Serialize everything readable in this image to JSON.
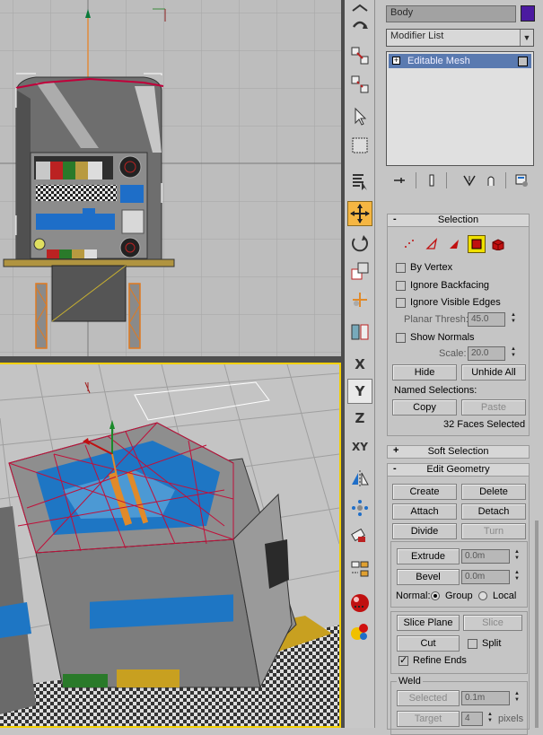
{
  "object": {
    "name": "Body",
    "color": "#4b1aa0"
  },
  "modifier_list": {
    "label": "Modifier List"
  },
  "stack": {
    "items": [
      {
        "label": "Editable Mesh"
      }
    ]
  },
  "toolbar": {
    "axis_x": "X",
    "axis_y": "Y",
    "axis_z": "Z",
    "axis_xy": "XY"
  },
  "selection": {
    "title": "Selection",
    "levels": [
      "vertex-icon",
      "edge-icon",
      "face-icon",
      "polygon-icon",
      "element-icon"
    ],
    "active_level": "polygon-icon",
    "by_vertex": "By Vertex",
    "ignore_backfacing": "Ignore Backfacing",
    "ignore_visible_edges": "Ignore Visible Edges",
    "planar_thresh_label": "Planar Thresh:",
    "planar_thresh_value": "45.0",
    "show_normals": "Show Normals",
    "scale_label": "Scale:",
    "scale_value": "20.0",
    "hide": "Hide",
    "unhide_all": "Unhide All",
    "named_selections": "Named Selections:",
    "copy": "Copy",
    "paste": "Paste",
    "status": "32 Faces Selected"
  },
  "soft_selection": {
    "title": "Soft Selection",
    "sign": "+"
  },
  "edit_geometry": {
    "title": "Edit Geometry",
    "sign": "-",
    "create": "Create",
    "delete": "Delete",
    "attach": "Attach",
    "detach": "Detach",
    "divide": "Divide",
    "turn": "Turn",
    "extrude": "Extrude",
    "extrude_value": "0.0m",
    "bevel": "Bevel",
    "bevel_value": "0.0m",
    "normal_label": "Normal:",
    "group": "Group",
    "local": "Local",
    "slice_plane": "Slice Plane",
    "slice": "Slice",
    "cut": "Cut",
    "split": "Split",
    "refine_ends": "Refine Ends",
    "weld_title": "Weld",
    "selected": "Selected",
    "selected_value": "0.1m",
    "target": "Target",
    "target_value": "4",
    "pixels": "pixels"
  },
  "selection_sign": "-"
}
